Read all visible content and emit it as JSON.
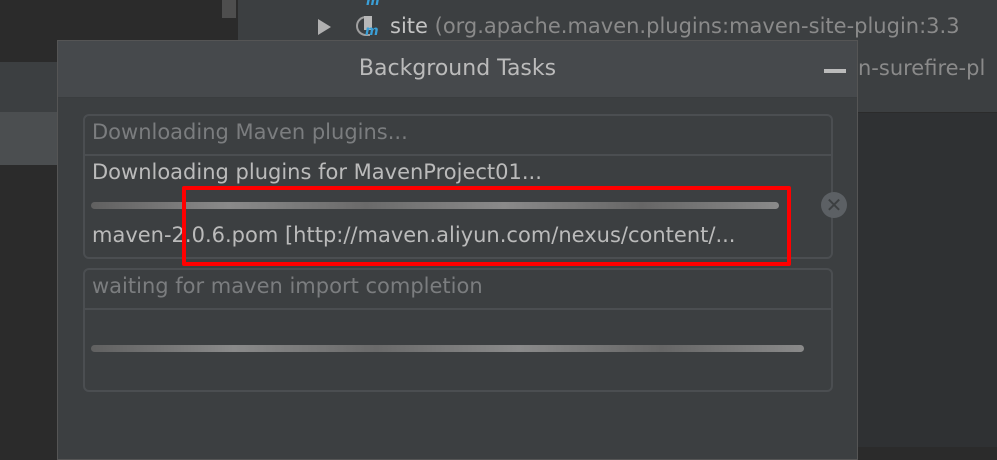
{
  "background_tree": {
    "row1": {
      "name": "site",
      "detail": "(org.apache.maven.plugins:maven-site-plugin:3.3",
      "icon": "maven-plugin-icon"
    },
    "row2": {
      "detail": "n-surefire-pl"
    }
  },
  "dialog": {
    "title": "Background Tasks",
    "tasks": [
      {
        "header": "Downloading Maven plugins...",
        "text": "Downloading plugins for MavenProject01...",
        "subtext": "maven-2.0.6.pom [http://maven.aliyun.com/nexus/content/...",
        "progress": "indeterminate"
      },
      {
        "header": "waiting for maven import completion",
        "progress": "indeterminate"
      }
    ]
  },
  "annotation_color": "#ff0000"
}
